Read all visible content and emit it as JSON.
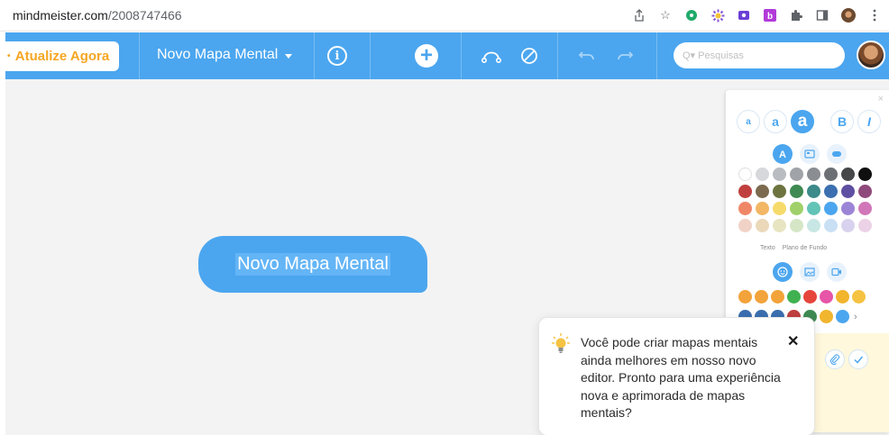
{
  "browser": {
    "url_host": "mindmeister.com",
    "url_path": "/2008747466",
    "icons": [
      "share-icon",
      "star-icon",
      "extension-green-icon",
      "extension-purple-icon",
      "screen-record-icon",
      "bitly-icon",
      "puzzle-icon",
      "sidebar-icon",
      "profile-avatar",
      "menu-icon"
    ]
  },
  "toolbar": {
    "upgrade_label": "Atualize Agora",
    "map_title": "Novo Mapa Mental",
    "search_placeholder": "Q▾ Pesquisas",
    "accent_color": "#4ba6ef",
    "upgrade_text_color": "#f5a623"
  },
  "canvas": {
    "root_node_text": "Novo Mapa Mental"
  },
  "style_panel": {
    "close": "×",
    "font_buttons": [
      "a",
      "a",
      "a",
      "B",
      "I"
    ],
    "tab_icons": [
      "text-color-icon",
      "node-shape-icon",
      "border-icon"
    ],
    "colors": [
      "#ffffff",
      "#d6d8db",
      "#b9bcc0",
      "#a0a3a7",
      "#8a8d91",
      "#6c6f73",
      "#454749",
      "#101010",
      "#c0403f",
      "#7b6a4f",
      "#6e7440",
      "#3f8a52",
      "#3c8a8a",
      "#3b6fb0",
      "#5e4fa2",
      "#8f4a7c",
      "#ef8767",
      "#f3b664",
      "#f6da6a",
      "#9fd06a",
      "#62c4b6",
      "#4ba6ef",
      "#9c84d6",
      "#d176b8",
      "#f1d2c6",
      "#ead8b9",
      "#e7e4c2",
      "#d5e6c6",
      "#c8e7e4",
      "#c9dff4",
      "#d9d2ee",
      "#ecd2e6"
    ],
    "legend": [
      "Texto",
      "Plano de Fundo"
    ],
    "media_tabs": [
      "emoji-icon",
      "image-icon",
      "video-icon"
    ],
    "emoji_row1": [
      "#f2a33a",
      "#f2a33a",
      "#f2a33a",
      "#3fb150",
      "#e6453c",
      "#e655a7",
      "#f2b52e",
      "#f5c242"
    ],
    "emoji_row2": [
      "#3b6fb0",
      "#3b6fb0",
      "#3b6fb0",
      "#c0403f",
      "#3f8a52",
      "#f2b52e",
      "#4ba6ef"
    ],
    "more": "›",
    "footer_buttons": [
      "attachment-icon",
      "check-icon"
    ]
  },
  "tooltip": {
    "text": "Você pode criar mapas mentais ainda melhores em nosso novo editor. Pronto para uma experiência nova e aprimorada de mapas mentais?",
    "close": "✕"
  }
}
